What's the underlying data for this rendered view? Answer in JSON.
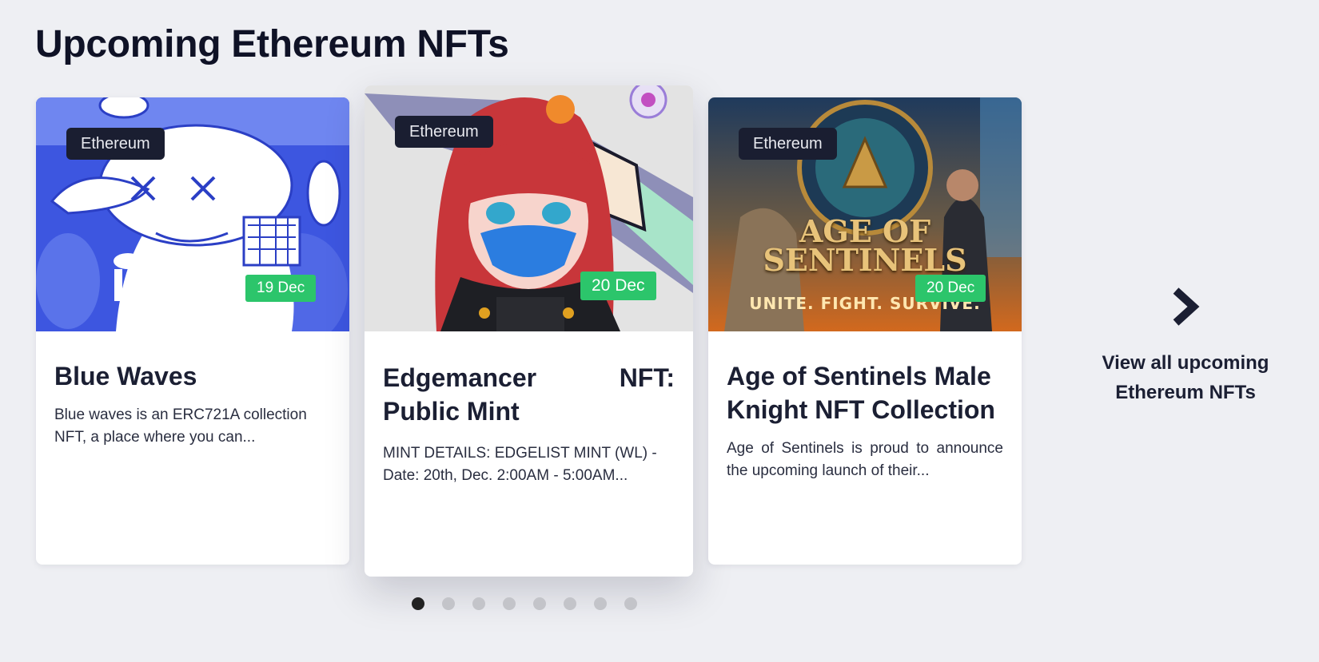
{
  "page": {
    "title": "Upcoming Ethereum NFTs"
  },
  "cards": [
    {
      "chain": "Ethereum",
      "date": "19 Dec",
      "title": "Blue Waves",
      "description": "Blue waves is an ERC721A collection NFT, a place where you can..."
    },
    {
      "chain": "Ethereum",
      "date": "20 Dec",
      "title_line1_left": "Edgemancer",
      "title_line1_right": "NFT:",
      "title_line2": "Public Mint",
      "description": "MINT DETAILS: EDGELIST MINT (WL) - Date: 20th, Dec. 2:00AM - 5:00AM..."
    },
    {
      "chain": "Ethereum",
      "date": "20 Dec",
      "title": "Age of Sentinels Male Knight NFT Collection",
      "description": "Age of Sentinels is proud to announce the upcoming launch of their...",
      "image_text": {
        "line1": "AGE OF",
        "line2": "SENTINELS",
        "tagline": "UNITE. FIGHT. SURVIVE."
      }
    }
  ],
  "view_all": {
    "line1": "View all upcoming",
    "line2": "Ethereum NFTs",
    "icon": "chevron-right-icon"
  },
  "pagination": {
    "count": 8,
    "active_index": 0
  },
  "colors": {
    "background": "#eeeff3",
    "badge_dark": "#1a1e31",
    "badge_green": "#2cc56b",
    "text_dark": "#1b1f33"
  }
}
